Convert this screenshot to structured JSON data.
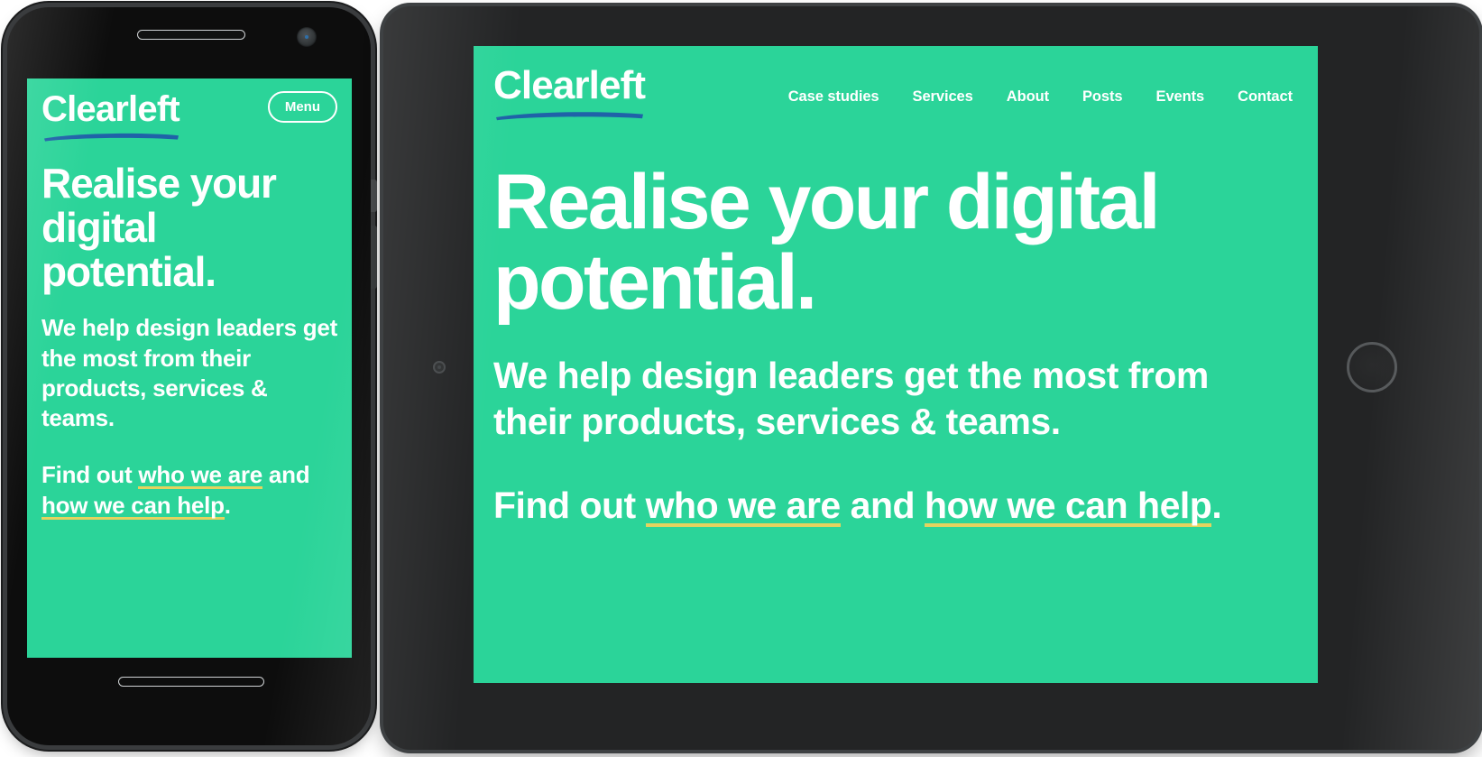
{
  "colors": {
    "brand_green": "#2BD499",
    "logo_underline_blue": "#1F62A8",
    "link_underline_gold": "#E4D35F",
    "text_white": "#FFFFFF",
    "pattern_stroke": "#24BE89",
    "phone_frame": "#0D0D0D",
    "tablet_frame": "#232425"
  },
  "brand": {
    "logo_text": "Clearleft"
  },
  "phone": {
    "menu_label": "Menu",
    "heading": "Realise your digital potential.",
    "lead": "We help design leaders get the most from their products, services & teams.",
    "find_prefix": "Find out ",
    "link_one": "who we are",
    "find_middle": " and ",
    "link_two": "how we can help",
    "find_suffix": "."
  },
  "tablet": {
    "nav": [
      {
        "label": "Case studies"
      },
      {
        "label": "Services"
      },
      {
        "label": "About"
      },
      {
        "label": "Posts"
      },
      {
        "label": "Events"
      },
      {
        "label": "Contact"
      }
    ],
    "heading": "Realise your digital potential.",
    "lead": "We help design leaders get the most from their products, services & teams.",
    "find_prefix": "Find out ",
    "link_one": "who we are",
    "find_middle": " and ",
    "link_two": "how we can help",
    "find_suffix": "."
  },
  "icons": {
    "phone_speaker": "speaker-grille-icon",
    "phone_camera": "front-camera-icon",
    "phone_home": "home-indicator-icon",
    "tablet_home": "home-button-icon",
    "tablet_camera": "front-camera-icon"
  }
}
